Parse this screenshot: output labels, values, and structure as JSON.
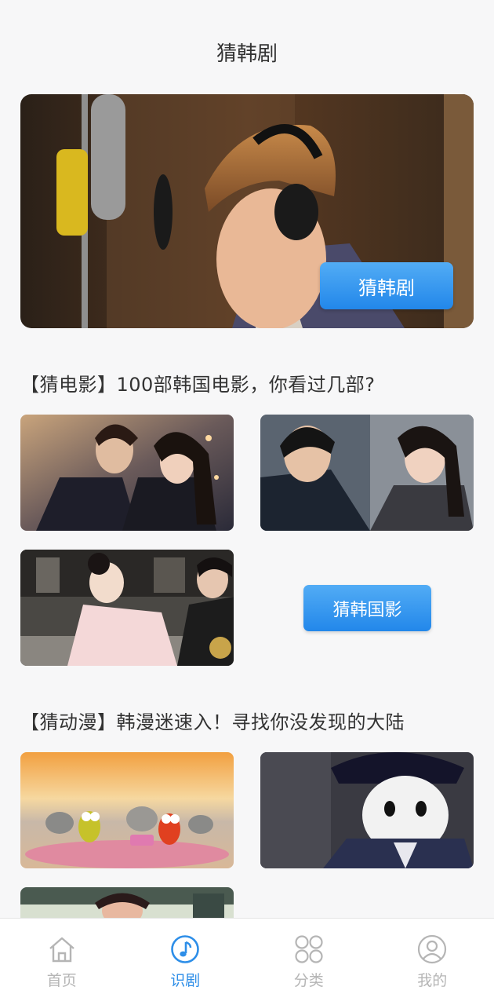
{
  "header": {
    "title": "猜韩剧"
  },
  "hero": {
    "button_label": "猜韩剧"
  },
  "movies_section": {
    "title": "【猜电影】100部韩国电影，你看过几部?",
    "button_label": "猜韩国影"
  },
  "anime_section": {
    "title": "【猜动漫】韩漫迷速入！寻找你没发现的大陆"
  },
  "tabbar": {
    "accent_color": "#2d8ee8",
    "inactive_color": "#b5b5b5",
    "items": [
      {
        "label": "首页",
        "icon": "home-icon",
        "active": false
      },
      {
        "label": "识剧",
        "icon": "music-note-icon",
        "active": true
      },
      {
        "label": "分类",
        "icon": "grid-circles-icon",
        "active": false
      },
      {
        "label": "我的",
        "icon": "user-icon",
        "active": false
      }
    ]
  }
}
